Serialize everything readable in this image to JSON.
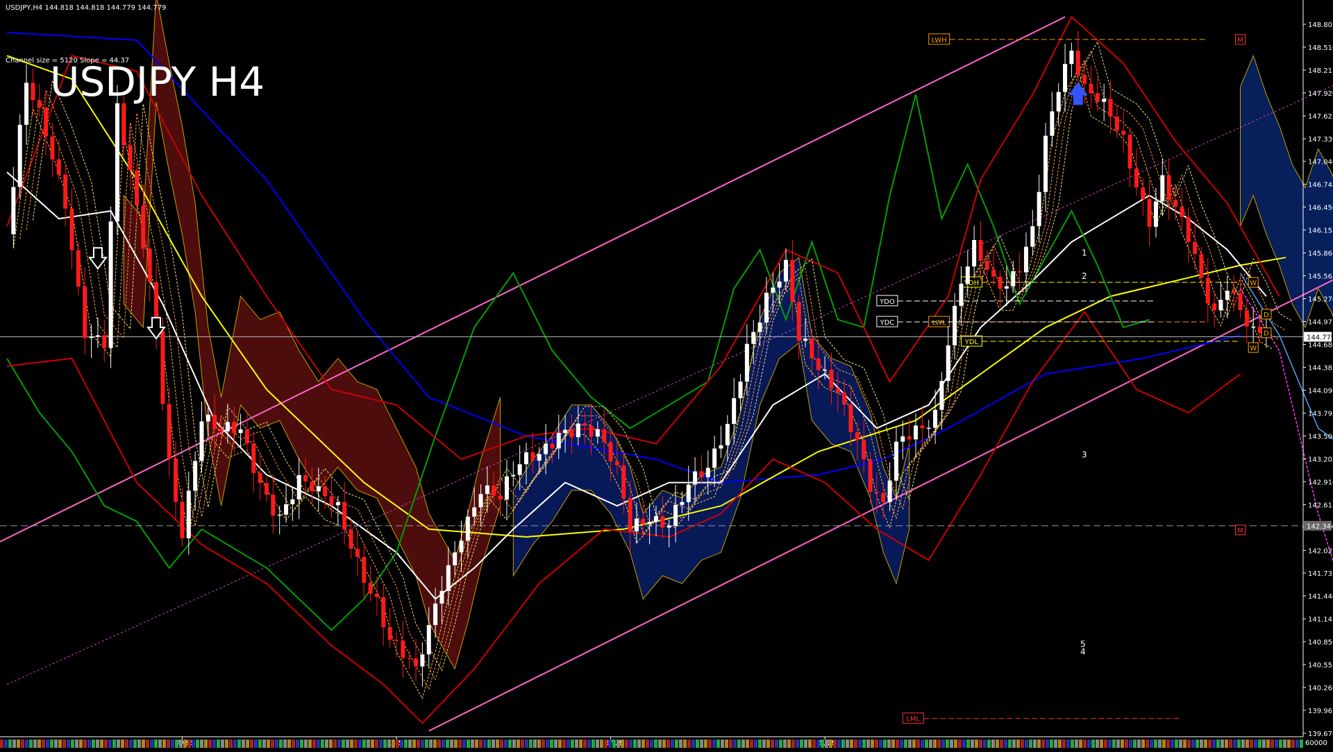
{
  "header": {
    "symbol_line": "USDJPY,H4  144.818 144.818 144.779 144.779",
    "channel_info": "Channel size = 5120 Slope = 44.37",
    "title": "USDJPY H4"
  },
  "chart_data": {
    "type": "candlestick",
    "symbol": "USDJPY",
    "timeframe": "H4",
    "ylim": [
      139.67,
      148.805
    ],
    "y_ticks": [
      "148.805",
      "148.510",
      "148.215",
      "147.920",
      "147.625",
      "147.330",
      "147.040",
      "146.745",
      "146.450",
      "146.155",
      "145.860",
      "145.565",
      "145.270",
      "144.975",
      "144.680",
      "144.385",
      "144.090",
      "143.795",
      "143.500",
      "143.205",
      "142.910",
      "142.615",
      "142.320",
      "142.025",
      "141.735",
      "141.440",
      "141.145",
      "140.850",
      "140.555",
      "140.260",
      "139.965",
      "139.670"
    ],
    "x_ticks": [
      {
        "label": "4/28",
        "bar": 27
      },
      {
        "label": "5/5",
        "bar": 60
      },
      {
        "label": "5/12",
        "bar": 93
      },
      {
        "label": "5/19",
        "bar": 126
      }
    ],
    "current_price": "144.779",
    "line_price": "142.344",
    "bottom_right_label": "60000",
    "close_path": [
      [
        0,
        146.1
      ],
      [
        3,
        147.9
      ],
      [
        6,
        147.3
      ],
      [
        9,
        146.6
      ],
      [
        12,
        145.0
      ],
      [
        15,
        144.7
      ],
      [
        17,
        147.6
      ],
      [
        19,
        146.7
      ],
      [
        21,
        145.9
      ],
      [
        23,
        144.9
      ],
      [
        25,
        143.3
      ],
      [
        27,
        142.4
      ],
      [
        30,
        143.7
      ],
      [
        33,
        143.4
      ],
      [
        36,
        143.5
      ],
      [
        39,
        143.0
      ],
      [
        42,
        142.6
      ],
      [
        45,
        142.9
      ],
      [
        48,
        142.6
      ],
      [
        51,
        142.5
      ],
      [
        54,
        142.0
      ],
      [
        57,
        141.5
      ],
      [
        59,
        140.9
      ],
      [
        61,
        140.6
      ],
      [
        63,
        140.3
      ],
      [
        65,
        140.9
      ],
      [
        67,
        141.6
      ],
      [
        70,
        142.4
      ],
      [
        73,
        142.9
      ],
      [
        76,
        142.6
      ],
      [
        79,
        143.0
      ],
      [
        82,
        143.3
      ],
      [
        85,
        143.7
      ],
      [
        88,
        143.7
      ],
      [
        91,
        143.4
      ],
      [
        94,
        142.9
      ],
      [
        96,
        142.3
      ],
      [
        99,
        142.6
      ],
      [
        102,
        142.5
      ],
      [
        105,
        142.8
      ],
      [
        108,
        142.9
      ],
      [
        111,
        143.6
      ],
      [
        114,
        144.8
      ],
      [
        117,
        145.4
      ],
      [
        120,
        145.6
      ],
      [
        122,
        144.6
      ],
      [
        125,
        144.3
      ],
      [
        128,
        144.2
      ],
      [
        131,
        143.6
      ],
      [
        133,
        142.9
      ],
      [
        135,
        142.5
      ],
      [
        137,
        143.2
      ],
      [
        139,
        143.4
      ],
      [
        141,
        143.6
      ],
      [
        143,
        143.9
      ],
      [
        145,
        144.9
      ],
      [
        147,
        145.6
      ],
      [
        149,
        145.9
      ],
      [
        152,
        145.3
      ],
      [
        154,
        145.3
      ],
      [
        156,
        145.7
      ],
      [
        158,
        146.3
      ],
      [
        160,
        147.5
      ],
      [
        162,
        148.1
      ],
      [
        164,
        148.4
      ],
      [
        166,
        147.8
      ],
      [
        168,
        147.7
      ],
      [
        170,
        147.6
      ],
      [
        172,
        147.4
      ],
      [
        174,
        146.9
      ],
      [
        176,
        146.4
      ],
      [
        178,
        146.8
      ],
      [
        180,
        146.3
      ],
      [
        182,
        145.9
      ],
      [
        184,
        145.4
      ],
      [
        186,
        145.1
      ],
      [
        188,
        145.6
      ],
      [
        190,
        145.3
      ],
      [
        192,
        144.9
      ],
      [
        194,
        144.8
      ]
    ],
    "indicator_lines": [
      {
        "name": "",
        "color": "#0000ff",
        "points": [
          [
            0,
            148.7
          ],
          [
            20,
            148.6
          ],
          [
            40,
            146.8
          ],
          [
            55,
            145.0
          ],
          [
            65,
            144.0
          ],
          [
            80,
            143.5
          ],
          [
            100,
            143.2
          ],
          [
            110,
            142.9
          ],
          [
            125,
            143.0
          ],
          [
            135,
            143.2
          ],
          [
            145,
            143.6
          ],
          [
            160,
            144.3
          ],
          [
            175,
            144.5
          ],
          [
            190,
            144.8
          ]
        ]
      },
      {
        "name": "",
        "color": "#ffff00",
        "points": [
          [
            0,
            148.4
          ],
          [
            10,
            148.1
          ],
          [
            20,
            146.8
          ],
          [
            30,
            145.3
          ],
          [
            40,
            144.1
          ],
          [
            55,
            142.9
          ],
          [
            65,
            142.3
          ],
          [
            80,
            142.2
          ],
          [
            95,
            142.3
          ],
          [
            110,
            142.6
          ],
          [
            125,
            143.3
          ],
          [
            140,
            143.7
          ],
          [
            150,
            144.3
          ],
          [
            160,
            144.9
          ],
          [
            170,
            145.3
          ],
          [
            180,
            145.5
          ],
          [
            190,
            145.7
          ],
          [
            197,
            145.8
          ]
        ]
      },
      {
        "name": "",
        "color": "#ffffff",
        "points": [
          [
            0,
            146.9
          ],
          [
            8,
            146.3
          ],
          [
            16,
            146.4
          ],
          [
            24,
            145.2
          ],
          [
            32,
            143.7
          ],
          [
            40,
            143.0
          ],
          [
            50,
            142.6
          ],
          [
            60,
            142.0
          ],
          [
            66,
            141.4
          ],
          [
            72,
            141.8
          ],
          [
            78,
            142.3
          ],
          [
            86,
            142.9
          ],
          [
            94,
            142.6
          ],
          [
            102,
            142.9
          ],
          [
            110,
            142.9
          ],
          [
            118,
            143.9
          ],
          [
            126,
            144.3
          ],
          [
            134,
            143.6
          ],
          [
            142,
            143.9
          ],
          [
            150,
            144.9
          ],
          [
            158,
            145.5
          ],
          [
            164,
            146.0
          ],
          [
            170,
            146.3
          ],
          [
            176,
            146.6
          ],
          [
            182,
            146.3
          ],
          [
            188,
            145.9
          ],
          [
            194,
            145.3
          ]
        ]
      },
      {
        "name": "",
        "color": "#00a000",
        "points": [
          [
            0,
            144.5
          ],
          [
            5,
            143.8
          ],
          [
            10,
            143.3
          ],
          [
            15,
            142.6
          ],
          [
            20,
            142.4
          ],
          [
            25,
            141.8
          ],
          [
            30,
            142.3
          ],
          [
            40,
            141.8
          ],
          [
            50,
            141.0
          ],
          [
            55,
            141.4
          ],
          [
            60,
            142.0
          ],
          [
            66,
            143.5
          ],
          [
            72,
            144.9
          ],
          [
            78,
            145.6
          ],
          [
            84,
            144.6
          ],
          [
            90,
            144.0
          ],
          [
            96,
            143.6
          ],
          [
            102,
            143.9
          ],
          [
            108,
            144.2
          ],
          [
            112,
            145.4
          ],
          [
            116,
            145.9
          ],
          [
            120,
            145.0
          ],
          [
            124,
            146.0
          ],
          [
            128,
            145.0
          ],
          [
            132,
            144.9
          ],
          [
            136,
            146.6
          ],
          [
            140,
            147.9
          ],
          [
            144,
            146.3
          ],
          [
            148,
            147.0
          ],
          [
            152,
            146.2
          ],
          [
            156,
            145.2
          ],
          [
            160,
            145.8
          ],
          [
            164,
            146.4
          ],
          [
            168,
            145.7
          ],
          [
            172,
            144.9
          ],
          [
            176,
            145.0
          ]
        ]
      },
      {
        "name": "",
        "color": "#cc0000",
        "points": [
          [
            0,
            146.2
          ],
          [
            10,
            148.4
          ],
          [
            20,
            148.2
          ],
          [
            30,
            146.6
          ],
          [
            40,
            145.3
          ],
          [
            50,
            144.1
          ],
          [
            60,
            143.9
          ],
          [
            70,
            143.2
          ],
          [
            80,
            143.5
          ],
          [
            90,
            143.6
          ],
          [
            100,
            143.4
          ],
          [
            110,
            144.4
          ],
          [
            120,
            145.9
          ],
          [
            128,
            145.6
          ],
          [
            136,
            144.2
          ],
          [
            145,
            145.3
          ],
          [
            150,
            146.8
          ],
          [
            158,
            147.9
          ],
          [
            164,
            148.9
          ],
          [
            172,
            148.3
          ],
          [
            180,
            147.3
          ],
          [
            188,
            146.5
          ],
          [
            196,
            145.3
          ]
        ]
      },
      {
        "name": "",
        "color": "#cc0000",
        "points": [
          [
            0,
            144.4
          ],
          [
            10,
            144.5
          ],
          [
            20,
            142.9
          ],
          [
            30,
            142.1
          ],
          [
            40,
            141.6
          ],
          [
            50,
            140.8
          ],
          [
            58,
            140.3
          ],
          [
            64,
            139.8
          ],
          [
            72,
            140.5
          ],
          [
            82,
            141.6
          ],
          [
            92,
            142.3
          ],
          [
            102,
            142.2
          ],
          [
            110,
            142.5
          ],
          [
            118,
            143.2
          ],
          [
            126,
            142.9
          ],
          [
            134,
            142.3
          ],
          [
            142,
            141.9
          ],
          [
            150,
            143.0
          ],
          [
            158,
            144.2
          ],
          [
            166,
            145.1
          ],
          [
            174,
            144.1
          ],
          [
            182,
            143.8
          ],
          [
            190,
            144.3
          ]
        ]
      }
    ],
    "channel_lines": [
      {
        "from": [
          -2,
          142.1
        ],
        "to": [
          163,
          148.9
        ]
      },
      {
        "from": [
          65,
          139.7
        ],
        "to": [
          240,
          147.0
        ]
      }
    ],
    "channel_mid": {
      "from": [
        0,
        140.3
      ],
      "to": [
        225,
        148.8
      ]
    },
    "projections": [
      {
        "color": "#4da6ff",
        "points": [
          [
            190,
            145.6
          ],
          [
            196,
            144.8
          ],
          [
            202,
            143.6
          ],
          [
            207,
            143.3
          ]
        ]
      },
      {
        "color": "#ff33ff",
        "points": [
          [
            190,
            145.4
          ],
          [
            196,
            144.6
          ],
          [
            202,
            142.5
          ],
          [
            208,
            140.9
          ]
        ]
      }
    ],
    "level_lines": [
      {
        "label": "LWH",
        "price": 148.61,
        "color": "#ff9900",
        "label_bar": 142
      },
      {
        "label": "LWL",
        "price": 144.97,
        "color": "#ff9900",
        "label_bar": 142
      },
      {
        "label": "LML",
        "price": 139.86,
        "color": "#ff3333",
        "label_bar": 138
      },
      {
        "label": "YDO",
        "price": 145.24,
        "color": "#ffffff",
        "label_bar": 134
      },
      {
        "label": "YDC",
        "price": 144.97,
        "color": "#ffffff",
        "label_bar": 134
      },
      {
        "label": "YDH",
        "price": 145.48,
        "color": "#ffff00",
        "label_bar": 147
      },
      {
        "label": "YDL",
        "price": 144.72,
        "color": "#ffff00",
        "label_bar": 147
      }
    ],
    "small_markers": [
      {
        "label": "M",
        "price": 148.61,
        "color": "#ff3333",
        "bar": 190
      },
      {
        "label": "M",
        "price": 142.29,
        "color": "#ff3333",
        "bar": 190
      },
      {
        "label": "W",
        "price": 145.48,
        "color": "#ffaa00",
        "bar": 192
      },
      {
        "label": "D",
        "price": 145.07,
        "color": "#ffaa00",
        "bar": 194
      },
      {
        "label": "D",
        "price": 144.83,
        "color": "#ffaa00",
        "bar": 194
      },
      {
        "label": "W",
        "price": 144.64,
        "color": "#ffaa00",
        "bar": 192
      }
    ],
    "wave_labels": [
      {
        "label": "1",
        "price": 145.86
      },
      {
        "label": "2",
        "price": 145.56
      },
      {
        "label": "3",
        "price": 143.26
      },
      {
        "label": "5",
        "price": 140.82
      },
      {
        "label": "4",
        "price": 140.72
      }
    ],
    "arrows": [
      {
        "direction": "down",
        "color": "#ffffff",
        "bar": 14,
        "price": 145.8
      },
      {
        "direction": "down",
        "color": "#ffffff",
        "bar": 23,
        "price": 144.9
      },
      {
        "direction": "up",
        "color": "#3355ff",
        "bar": 165,
        "price": 147.9
      }
    ],
    "bottom_strip": true
  }
}
